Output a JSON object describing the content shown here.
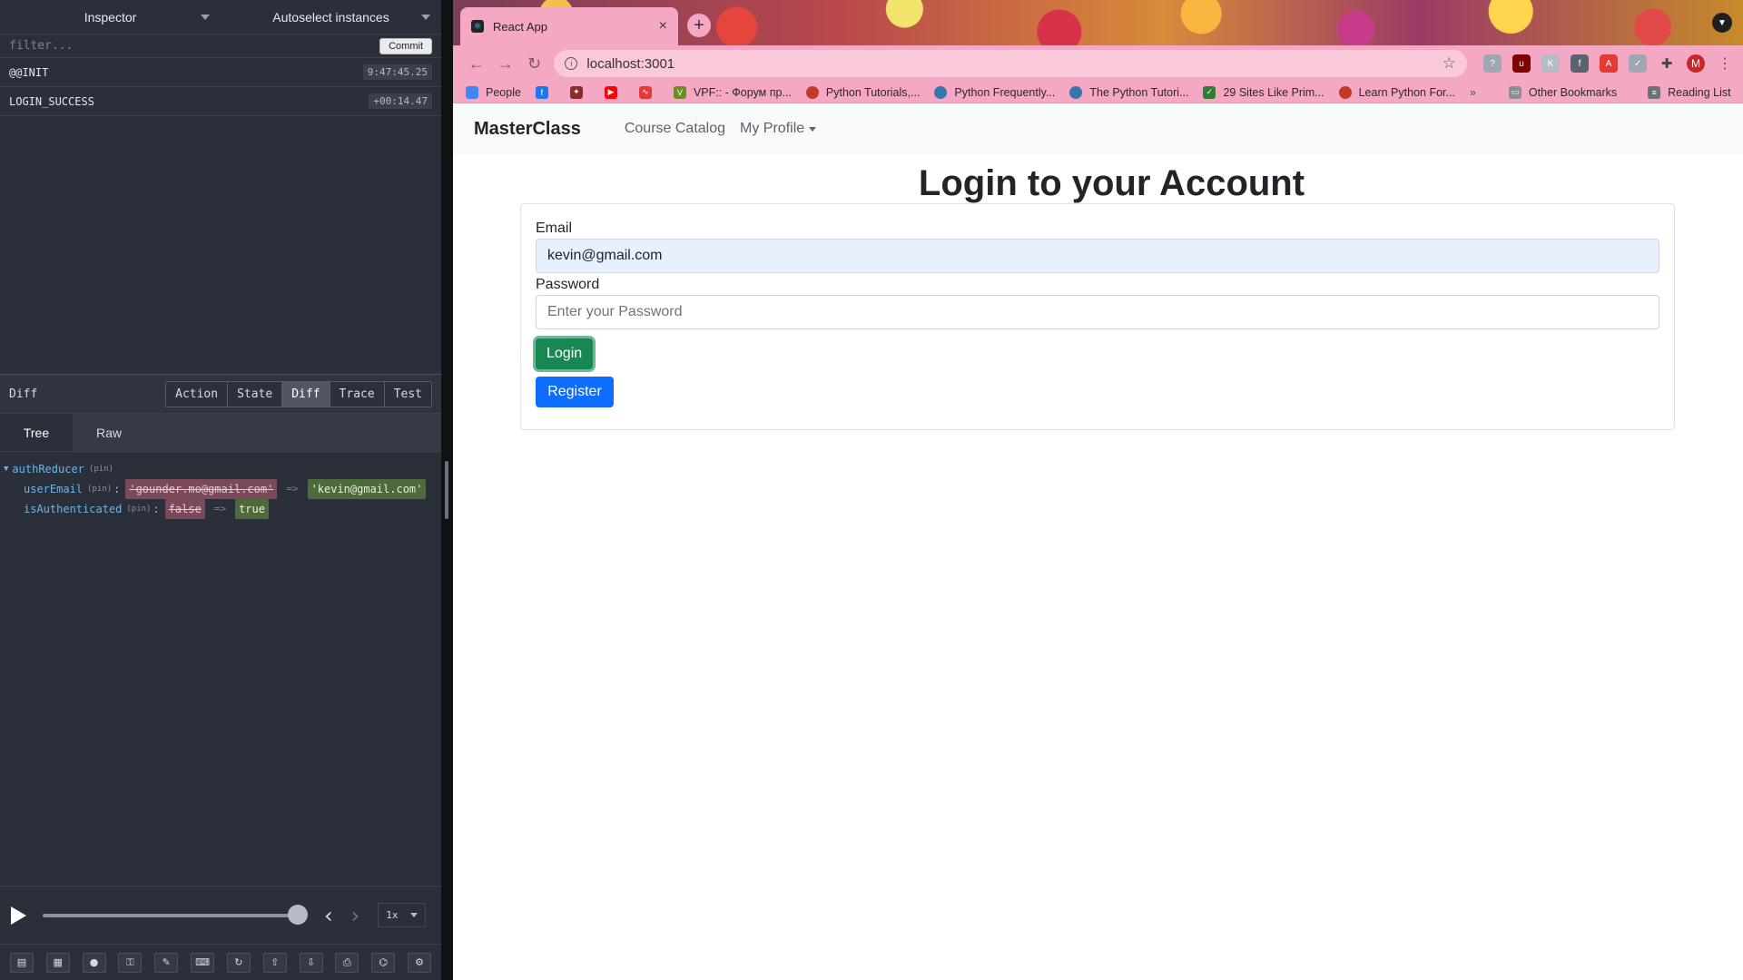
{
  "devtools": {
    "header": {
      "left_select": "Inspector",
      "right_select": "Autoselect instances"
    },
    "filter": {
      "placeholder": "filter...",
      "commit_label": "Commit"
    },
    "actions": [
      {
        "name": "@@INIT",
        "time": "9:47:45.25"
      },
      {
        "name": "LOGIN_SUCCESS",
        "time": "+00:14.47"
      }
    ],
    "panel_title": "Diff",
    "tabs": [
      "Action",
      "State",
      "Diff",
      "Trace",
      "Test"
    ],
    "active_tab": "Diff",
    "subtabs": [
      "Tree",
      "Raw"
    ],
    "active_subtab": "Tree",
    "diff": {
      "root_key": "authReducer",
      "pin_label": "(pin)",
      "arrow": "=>",
      "rows": [
        {
          "key": "userEmail",
          "old": "'gounder.mo@gmail.com'",
          "new": "'kevin@gmail.com'"
        },
        {
          "key": "isAuthenticated",
          "old": "false",
          "new": "true"
        }
      ]
    },
    "slider": {
      "speed": "1x",
      "progress": 1.0
    }
  },
  "browser": {
    "tab": {
      "title": "React App"
    },
    "address": {
      "url": "localhost:3001"
    },
    "profile_initial": "M",
    "bookmarks": [
      {
        "label": "People",
        "icon": "people-icon",
        "color": "#4285f4"
      },
      {
        "label": "",
        "icon": "facebook-icon",
        "color": "#1877f2"
      },
      {
        "label": "",
        "icon": "emblem-icon",
        "color": "#8d2a2a"
      },
      {
        "label": "",
        "icon": "youtube-icon",
        "color": "#ff0000"
      },
      {
        "label": "",
        "icon": "acrobat-icon",
        "color": "#e53935"
      },
      {
        "label": "VPF:: - Форум пр...",
        "icon": "vpf-icon",
        "color": "#6b8e23"
      },
      {
        "label": "Python Tutorials,...",
        "icon": "realpython-icon",
        "color": "#c0392b"
      },
      {
        "label": "Python Frequently...",
        "icon": "python-icon",
        "color": "#3776ab"
      },
      {
        "label": "The Python Tutori...",
        "icon": "python-icon",
        "color": "#3776ab"
      },
      {
        "label": "29 Sites Like Prim...",
        "icon": "check-icon",
        "color": "#2e7d32"
      },
      {
        "label": "Learn Python For...",
        "icon": "learn-icon",
        "color": "#c0392b"
      }
    ],
    "other_bookmarks": "Other Bookmarks",
    "reading_list": "Reading List"
  },
  "app": {
    "brand": "MasterClass",
    "nav": {
      "catalog": "Course Catalog",
      "profile": "My Profile"
    },
    "title": "Login to your Account",
    "form": {
      "email_label": "Email",
      "email_value": "kevin@gmail.com",
      "password_label": "Password",
      "password_placeholder": "Enter your Password",
      "login_label": "Login",
      "register_label": "Register"
    }
  },
  "colors": {
    "devtools_bg": "#2a2f3a",
    "chrome_pink": "#f4a8c4",
    "login_green": "#198754",
    "register_blue": "#0d6efd"
  }
}
